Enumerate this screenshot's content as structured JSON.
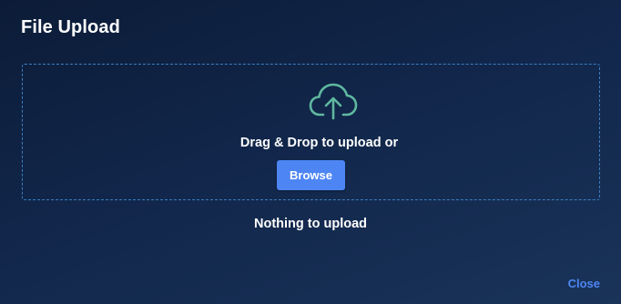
{
  "dialog": {
    "title": "File Upload"
  },
  "dropzone": {
    "icon": "cloud-upload-icon",
    "instruction": "Drag & Drop to upload or",
    "browse_label": "Browse"
  },
  "status": {
    "message": "Nothing to upload"
  },
  "footer": {
    "close_label": "Close"
  },
  "colors": {
    "background": "#11264a",
    "dropzone_border": "#3a7fc4",
    "icon": "#5fb8a0",
    "button": "#4d86f4",
    "link": "#4d86f4"
  }
}
